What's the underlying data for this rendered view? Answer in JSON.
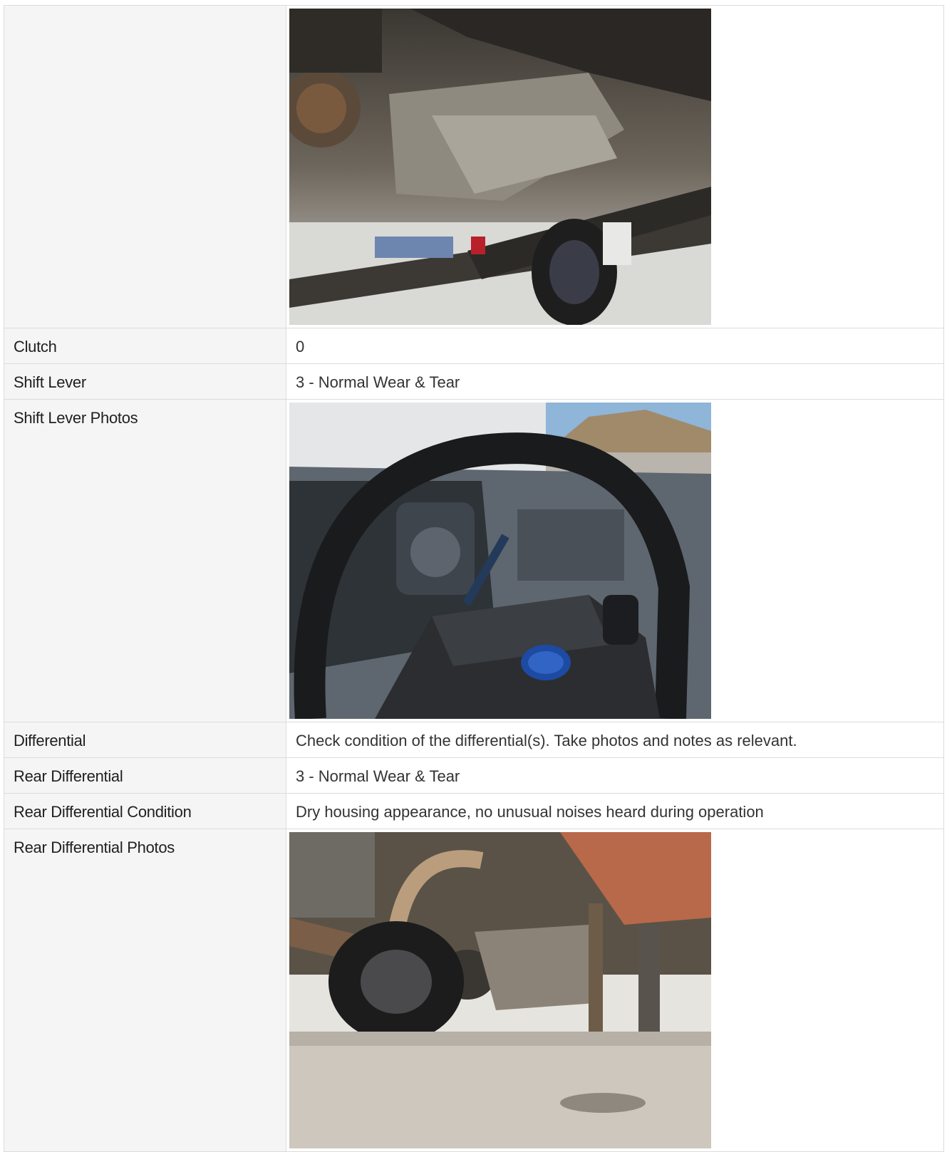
{
  "rows": [
    {
      "label": "",
      "type": "photo",
      "photo": "undercarriage-transmission-photo"
    },
    {
      "label": "Clutch",
      "type": "text",
      "value": "0"
    },
    {
      "label": "Shift Lever",
      "type": "text",
      "value": "3 - Normal Wear & Tear"
    },
    {
      "label": "Shift Lever Photos",
      "type": "photo",
      "photo": "steering-wheel-shift-lever-photo"
    },
    {
      "label": "Differential",
      "type": "text",
      "value": "Check condition of the differential(s). Take photos and notes as relevant."
    },
    {
      "label": "Rear Differential",
      "type": "text",
      "value": "3 - Normal Wear & Tear"
    },
    {
      "label": "Rear Differential Condition",
      "type": "text",
      "value": "Dry housing appearance, no unusual noises heard during operation"
    },
    {
      "label": "Rear Differential Photos",
      "type": "photo",
      "photo": "rear-differential-photo"
    }
  ],
  "colors": {
    "label_bg": "#f5f5f5",
    "border": "#dcdcdc",
    "text": "#333333"
  }
}
